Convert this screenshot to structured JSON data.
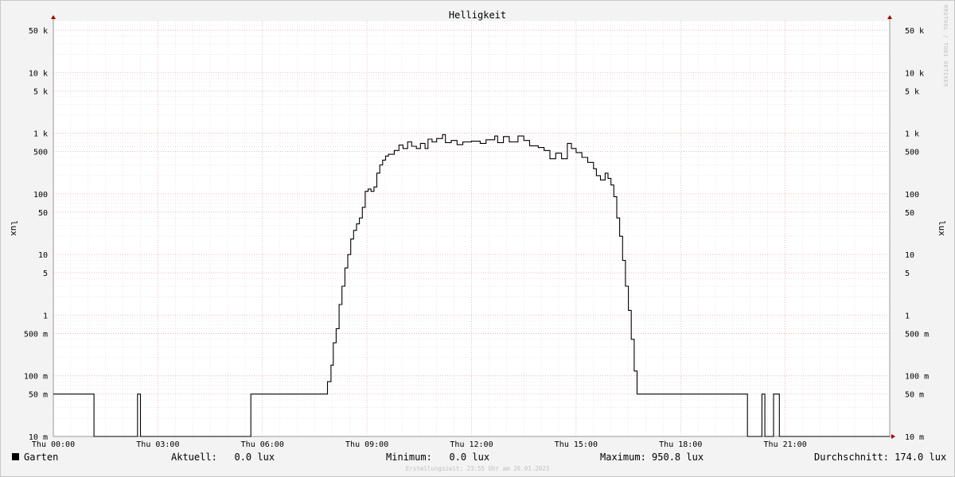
{
  "chart_data": {
    "type": "line",
    "title": "Helligkeit",
    "ylabel": "lux",
    "yscale": "log",
    "ylim": [
      0.01,
      80000
    ],
    "y_ticks": [
      {
        "v": 0.01,
        "label": "10 m"
      },
      {
        "v": 0.05,
        "label": "50 m"
      },
      {
        "v": 0.1,
        "label": "100 m"
      },
      {
        "v": 0.5,
        "label": "500 m"
      },
      {
        "v": 1,
        "label": "1"
      },
      {
        "v": 5,
        "label": "5"
      },
      {
        "v": 10,
        "label": "10"
      },
      {
        "v": 50,
        "label": "50"
      },
      {
        "v": 100,
        "label": "100"
      },
      {
        "v": 500,
        "label": "500"
      },
      {
        "v": 1000,
        "label": "1 k"
      },
      {
        "v": 5000,
        "label": "5 k"
      },
      {
        "v": 10000,
        "label": "10 k"
      },
      {
        "v": 50000,
        "label": "50 k"
      }
    ],
    "xlim": [
      "00:00",
      "24:00"
    ],
    "x_ticks": [
      {
        "t": "00:00",
        "label": "Thu 00:00"
      },
      {
        "t": "03:00",
        "label": "Thu 03:00"
      },
      {
        "t": "06:00",
        "label": "Thu 06:00"
      },
      {
        "t": "09:00",
        "label": "Thu 09:00"
      },
      {
        "t": "12:00",
        "label": "Thu 12:00"
      },
      {
        "t": "15:00",
        "label": "Thu 15:00"
      },
      {
        "t": "18:00",
        "label": "Thu 18:00"
      },
      {
        "t": "21:00",
        "label": "Thu 21:00"
      }
    ],
    "grid": true,
    "series": [
      {
        "name": "Garten",
        "color": "#000000",
        "points": [
          [
            "00:00",
            0.05
          ],
          [
            "01:10",
            0.05
          ],
          [
            "01:10",
            0.01
          ],
          [
            "02:25",
            0.01
          ],
          [
            "02:25",
            0.05
          ],
          [
            "02:30",
            0.05
          ],
          [
            "02:30",
            0.01
          ],
          [
            "05:40",
            0.01
          ],
          [
            "05:40",
            0.05
          ],
          [
            "07:52",
            0.05
          ],
          [
            "07:52",
            0.08
          ],
          [
            "07:58",
            0.08
          ],
          [
            "07:58",
            0.15
          ],
          [
            "08:02",
            0.15
          ],
          [
            "08:02",
            0.35
          ],
          [
            "08:07",
            0.35
          ],
          [
            "08:07",
            0.6
          ],
          [
            "08:12",
            0.6
          ],
          [
            "08:12",
            1.5
          ],
          [
            "08:17",
            1.5
          ],
          [
            "08:17",
            3
          ],
          [
            "08:22",
            3
          ],
          [
            "08:22",
            6
          ],
          [
            "08:27",
            6
          ],
          [
            "08:27",
            10
          ],
          [
            "08:32",
            10
          ],
          [
            "08:32",
            18
          ],
          [
            "08:37",
            18
          ],
          [
            "08:37",
            25
          ],
          [
            "08:42",
            25
          ],
          [
            "08:42",
            32
          ],
          [
            "08:47",
            32
          ],
          [
            "08:47",
            40
          ],
          [
            "08:52",
            40
          ],
          [
            "08:52",
            60
          ],
          [
            "08:57",
            60
          ],
          [
            "08:57",
            110
          ],
          [
            "09:02",
            110
          ],
          [
            "09:02",
            120
          ],
          [
            "09:07",
            120
          ],
          [
            "09:07",
            110
          ],
          [
            "09:12",
            110
          ],
          [
            "09:12",
            130
          ],
          [
            "09:17",
            130
          ],
          [
            "09:17",
            220
          ],
          [
            "09:22",
            220
          ],
          [
            "09:22",
            300
          ],
          [
            "09:27",
            300
          ],
          [
            "09:27",
            360
          ],
          [
            "09:32",
            360
          ],
          [
            "09:32",
            420
          ],
          [
            "09:37",
            420
          ],
          [
            "09:37",
            450
          ],
          [
            "09:47",
            450
          ],
          [
            "09:47",
            520
          ],
          [
            "09:55",
            520
          ],
          [
            "09:55",
            640
          ],
          [
            "10:02",
            640
          ],
          [
            "10:02",
            560
          ],
          [
            "10:10",
            560
          ],
          [
            "10:10",
            720
          ],
          [
            "10:17",
            720
          ],
          [
            "10:17",
            610
          ],
          [
            "10:25",
            610
          ],
          [
            "10:25",
            560
          ],
          [
            "10:32",
            560
          ],
          [
            "10:32",
            680
          ],
          [
            "10:40",
            680
          ],
          [
            "10:40",
            560
          ],
          [
            "10:45",
            560
          ],
          [
            "10:45",
            800
          ],
          [
            "10:52",
            800
          ],
          [
            "10:52",
            720
          ],
          [
            "11:00",
            720
          ],
          [
            "11:00",
            820
          ],
          [
            "11:10",
            820
          ],
          [
            "11:10",
            950
          ],
          [
            "11:15",
            950
          ],
          [
            "11:15",
            700
          ],
          [
            "11:25",
            700
          ],
          [
            "11:25",
            760
          ],
          [
            "11:35",
            760
          ],
          [
            "11:35",
            650
          ],
          [
            "11:45",
            650
          ],
          [
            "11:45",
            720
          ],
          [
            "12:00",
            720
          ],
          [
            "12:00",
            740
          ],
          [
            "12:15",
            740
          ],
          [
            "12:15",
            680
          ],
          [
            "12:25",
            680
          ],
          [
            "12:25",
            780
          ],
          [
            "12:40",
            780
          ],
          [
            "12:40",
            900
          ],
          [
            "12:45",
            900
          ],
          [
            "12:45",
            700
          ],
          [
            "12:55",
            700
          ],
          [
            "12:55",
            880
          ],
          [
            "13:05",
            880
          ],
          [
            "13:05",
            720
          ],
          [
            "13:20",
            720
          ],
          [
            "13:20",
            900
          ],
          [
            "13:30",
            900
          ],
          [
            "13:30",
            760
          ],
          [
            "13:40",
            760
          ],
          [
            "13:40",
            620
          ],
          [
            "13:55",
            620
          ],
          [
            "13:55",
            580
          ],
          [
            "14:05",
            580
          ],
          [
            "14:05",
            520
          ],
          [
            "14:15",
            520
          ],
          [
            "14:15",
            380
          ],
          [
            "14:25",
            380
          ],
          [
            "14:25",
            470
          ],
          [
            "14:35",
            470
          ],
          [
            "14:35",
            380
          ],
          [
            "14:45",
            380
          ],
          [
            "14:45",
            680
          ],
          [
            "14:52",
            680
          ],
          [
            "14:52",
            560
          ],
          [
            "15:00",
            560
          ],
          [
            "15:00",
            480
          ],
          [
            "15:10",
            480
          ],
          [
            "15:10",
            400
          ],
          [
            "15:20",
            400
          ],
          [
            "15:20",
            330
          ],
          [
            "15:30",
            330
          ],
          [
            "15:30",
            260
          ],
          [
            "15:35",
            260
          ],
          [
            "15:35",
            200
          ],
          [
            "15:42",
            200
          ],
          [
            "15:42",
            170
          ],
          [
            "15:50",
            170
          ],
          [
            "15:50",
            220
          ],
          [
            "15:55",
            220
          ],
          [
            "15:55",
            180
          ],
          [
            "16:00",
            180
          ],
          [
            "16:00",
            140
          ],
          [
            "16:05",
            140
          ],
          [
            "16:05",
            90
          ],
          [
            "16:10",
            90
          ],
          [
            "16:10",
            40
          ],
          [
            "16:15",
            40
          ],
          [
            "16:15",
            20
          ],
          [
            "16:20",
            20
          ],
          [
            "16:20",
            8
          ],
          [
            "16:25",
            8
          ],
          [
            "16:25",
            3
          ],
          [
            "16:30",
            3
          ],
          [
            "16:30",
            1.2
          ],
          [
            "16:35",
            1.2
          ],
          [
            "16:35",
            0.4
          ],
          [
            "16:40",
            0.4
          ],
          [
            "16:40",
            0.12
          ],
          [
            "16:45",
            0.12
          ],
          [
            "16:45",
            0.05
          ],
          [
            "19:55",
            0.05
          ],
          [
            "19:55",
            0.01
          ],
          [
            "20:20",
            0.01
          ],
          [
            "20:20",
            0.05
          ],
          [
            "20:25",
            0.05
          ],
          [
            "20:25",
            0.01
          ],
          [
            "20:40",
            0.01
          ],
          [
            "20:40",
            0.05
          ],
          [
            "20:50",
            0.05
          ],
          [
            "20:50",
            0.01
          ],
          [
            "24:00",
            0.01
          ]
        ]
      }
    ]
  },
  "legend": {
    "series_name": "Garten",
    "current": "Aktuell:   0.0 lux",
    "minimum": "Minimum:   0.0 lux",
    "maximum": "Maximum: 950.8 lux",
    "average": "Durchschnitt: 174.0 lux"
  },
  "footer": "Erstellungszeit: 23:55 Uhr am 26.01.2023",
  "watermark": "RRDTOOL / TOBI OETIKER"
}
